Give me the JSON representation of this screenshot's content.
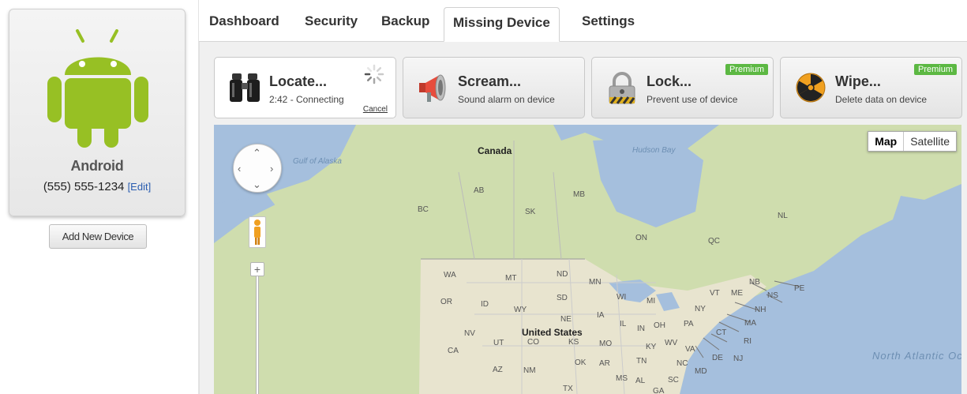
{
  "device": {
    "name": "Android",
    "phone": "(555) 555-1234",
    "edit_label": "[Edit]",
    "add_button": "Add New Device",
    "logo_color": "#97c024"
  },
  "tabs": [
    {
      "label": "Dashboard"
    },
    {
      "label": "Security"
    },
    {
      "label": "Backup"
    },
    {
      "label": "Missing Device",
      "active": true
    },
    {
      "label": "Settings"
    }
  ],
  "actions": {
    "locate": {
      "title": "Locate...",
      "status": "2:42 - Connecting",
      "cancel": "Cancel",
      "icon": "binoculars-icon"
    },
    "scream": {
      "title": "Scream...",
      "subtitle": "Sound alarm on device",
      "icon": "megaphone-icon"
    },
    "lock": {
      "title": "Lock...",
      "subtitle": "Prevent use of device",
      "badge": "Premium",
      "icon": "padlock-icon"
    },
    "wipe": {
      "title": "Wipe...",
      "subtitle": "Delete data on device",
      "badge": "Premium",
      "icon": "radiation-icon"
    }
  },
  "map": {
    "type_buttons": {
      "map": "Map",
      "satellite": "Satellite"
    },
    "zoom_in": "+",
    "labels": {
      "canada": "Canada",
      "united_states": "United States",
      "gulf_of_alaska": "Gulf of Alaska",
      "hudson_bay": "Hudson Bay",
      "north_atlantic_ocean": "North Atlantic Ocean",
      "ab": "AB",
      "bc": "BC",
      "mb": "MB",
      "sk": "SK",
      "on": "ON",
      "qc": "QC",
      "nl": "NL",
      "nb": "NB",
      "ns": "NS",
      "pe": "PE",
      "wa": "WA",
      "mt": "MT",
      "nd": "ND",
      "mn": "MN",
      "or": "OR",
      "id": "ID",
      "sd": "SD",
      "wy": "WY",
      "wi": "WI",
      "mi": "MI",
      "ne": "NE",
      "ia": "IA",
      "nv": "NV",
      "ut": "UT",
      "co": "CO",
      "ks": "KS",
      "mo": "MO",
      "il": "IL",
      "in": "IN",
      "oh": "OH",
      "pa": "PA",
      "ny": "NY",
      "vt": "VT",
      "me": "ME",
      "nh": "NH",
      "ma": "MA",
      "ct": "CT",
      "ri": "RI",
      "nj": "NJ",
      "de": "DE",
      "md": "MD",
      "va": "VA",
      "wv": "WV",
      "ky": "KY",
      "tn": "TN",
      "nc": "NC",
      "sc": "SC",
      "ca": "CA",
      "az": "AZ",
      "nm": "NM",
      "ok": "OK",
      "ar": "AR",
      "ms": "MS",
      "al": "AL",
      "ga": "GA",
      "tx": "TX"
    }
  },
  "colors": {
    "premium": "#5cb843",
    "water": "#a5bfdd",
    "land_green": "#cfddae",
    "land_tan": "#e8e4cf"
  }
}
